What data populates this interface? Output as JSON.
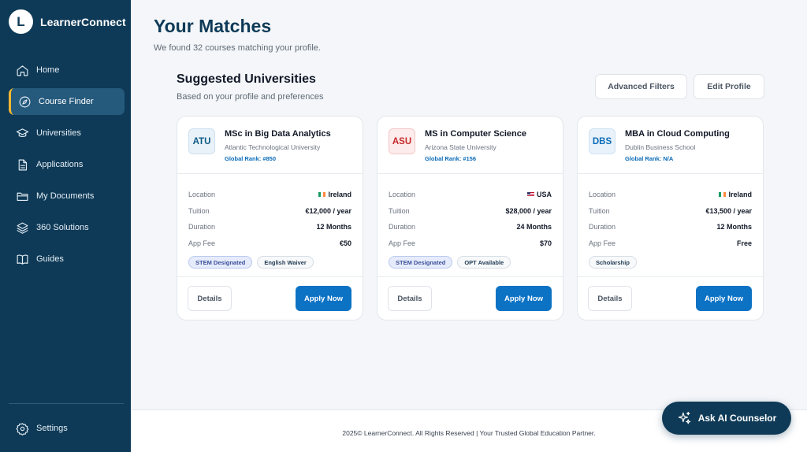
{
  "app": {
    "logo_letter": "L",
    "name": "LearnerConnect"
  },
  "sidebar": {
    "items": [
      {
        "label": "Home",
        "icon": "home-icon"
      },
      {
        "label": "Course Finder",
        "icon": "compass-icon",
        "active": true
      },
      {
        "label": "Universities",
        "icon": "graduation-cap-icon"
      },
      {
        "label": "Applications",
        "icon": "document-icon"
      },
      {
        "label": "My Documents",
        "icon": "folder-icon"
      },
      {
        "label": "360 Solutions",
        "icon": "layers-icon"
      },
      {
        "label": "Guides",
        "icon": "book-icon"
      }
    ],
    "settings_label": "Settings"
  },
  "header": {
    "title": "Your Matches",
    "subtitle": "We found 32 courses matching your profile."
  },
  "section": {
    "title": "Suggested Universities",
    "subtitle": "Based on your profile and preferences",
    "filters_label": "Advanced Filters",
    "edit_profile_label": "Edit Profile"
  },
  "labels": {
    "location": "Location",
    "tuition": "Tuition",
    "duration": "Duration",
    "app_fee": "App Fee",
    "details": "Details",
    "apply": "Apply Now"
  },
  "cards": [
    {
      "badge": "ATU",
      "badge_color": "#0e5a86",
      "badge_bg": "#e9f2f9",
      "badge_border": "#cde0ee",
      "title": "MSc in Big Data Analytics",
      "university": "Atlantic Technological University",
      "rank": "Global Rank: #850",
      "location": "Ireland",
      "tuition": "€12,000 / year",
      "duration": "12 Months",
      "app_fee": "€50",
      "tags": [
        "STEM Designated",
        "English Waiver"
      ]
    },
    {
      "badge": "ASU",
      "badge_color": "#c62828",
      "badge_bg": "#fdecec",
      "badge_border": "#f5c7c7",
      "title": "MS in Computer Science",
      "university": "Arizona State University",
      "rank": "Global Rank: #156",
      "location": "USA",
      "tuition": "$28,000 / year",
      "duration": "24 Months",
      "app_fee": "$70",
      "tags": [
        "STEM Designated",
        "OPT Available"
      ]
    },
    {
      "badge": "DBS",
      "badge_color": "#0b6bb8",
      "badge_bg": "#e9f2fb",
      "badge_border": "#cfe1f2",
      "title": "MBA in Cloud Computing",
      "university": "Dublin Business School",
      "rank": "Global Rank: N/A",
      "location": "Ireland",
      "tuition": "€13,500 / year",
      "duration": "12 Months",
      "app_fee": "Free",
      "tags": [
        "Scholarship"
      ]
    }
  ],
  "footer": {
    "text": "2025© LearnerConnect. All Rights Reserved | Your Trusted Global Education Partner."
  },
  "ai": {
    "label": "Ask AI Counselor",
    "icon": "sparkle-icon"
  },
  "colors": {
    "sidebar": "#0e3a57",
    "accent": "#0b72c4",
    "active_marker": "#f5b82e"
  }
}
